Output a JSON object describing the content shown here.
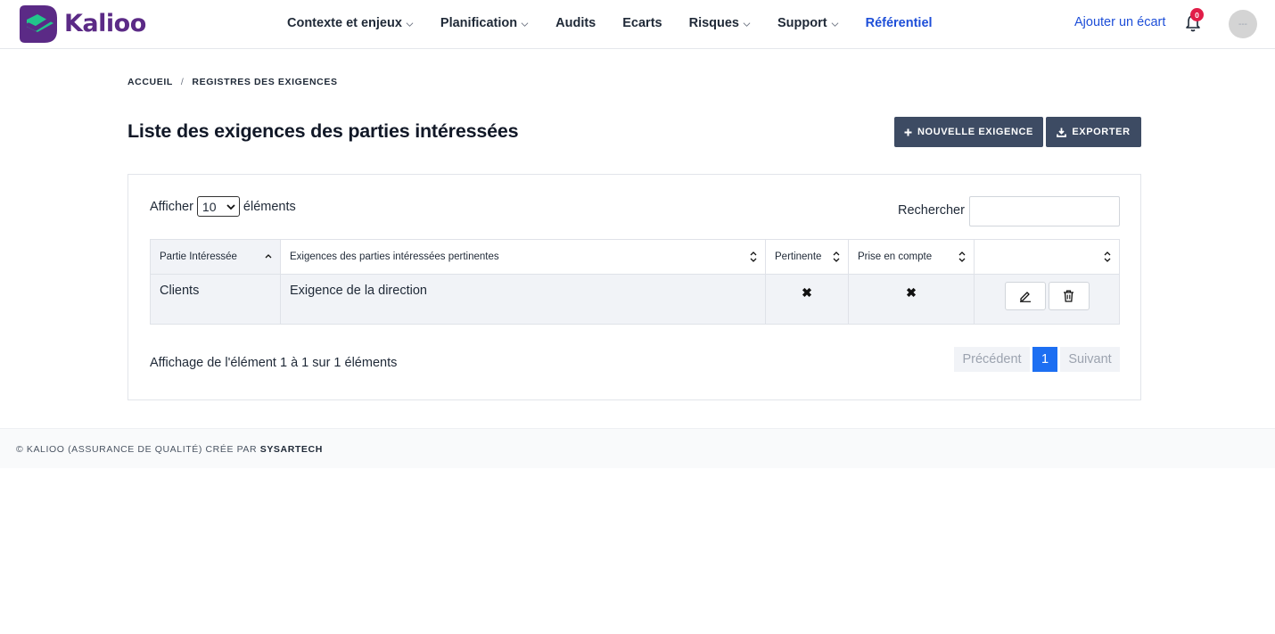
{
  "app": {
    "name": "Kalioo",
    "brand_color": "#5b2a86",
    "accent_color": "#1d4ed8"
  },
  "nav": {
    "items": [
      {
        "label": "Contexte et enjeux",
        "has_menu": true
      },
      {
        "label": "Planification",
        "has_menu": true
      },
      {
        "label": "Audits",
        "has_menu": false
      },
      {
        "label": "Ecarts",
        "has_menu": false
      },
      {
        "label": "Risques",
        "has_menu": true
      },
      {
        "label": "Support",
        "has_menu": true
      },
      {
        "label": "Référentiel",
        "has_menu": false,
        "active": true
      }
    ],
    "add_gap_link": "Ajouter un écart",
    "notification_count": "0",
    "avatar_text": "---"
  },
  "breadcrumb": {
    "home": "ACCUEIL",
    "separator": "/",
    "current": "REGISTRES DES EXIGENCES"
  },
  "page": {
    "title": "Liste des exigences des parties intéressées",
    "new_button": "NOUVELLE EXIGENCE",
    "export_button": "EXPORTER"
  },
  "table_controls": {
    "show_prefix": "Afficher",
    "page_size": "10",
    "show_suffix": "éléments",
    "search_label": "Rechercher :",
    "search_value": ""
  },
  "table": {
    "columns": [
      "Partie Intéressée",
      "Exigences des parties intéressées pertinentes",
      "Pertinente",
      "Prise en compte",
      ""
    ],
    "rows": [
      {
        "party": "Clients",
        "requirement": "Exigence de la direction",
        "pertinente": "✖",
        "prise_en_compte": "✖"
      }
    ]
  },
  "pagination": {
    "info": "Affichage de l'élément 1 à 1 sur 1 éléments",
    "previous": "Précédent",
    "current": "1",
    "next": "Suivant"
  },
  "footer": {
    "text": "© KALIOO (ASSURANCE DE QUALITÉ) CRÉE PAR",
    "author": "SYSARTECH"
  }
}
